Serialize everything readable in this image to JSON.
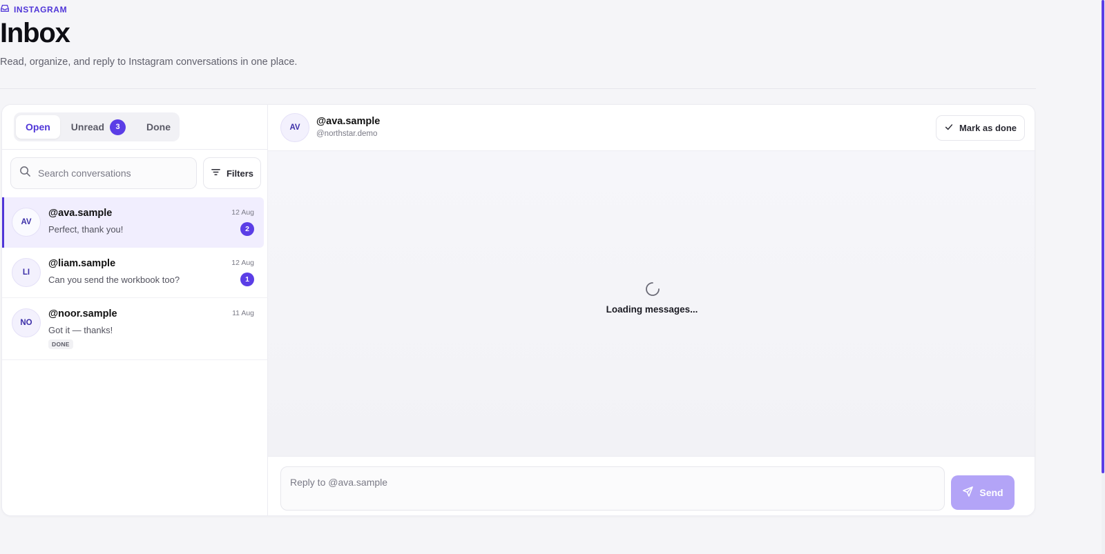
{
  "header": {
    "eyebrow": "INSTAGRAM",
    "title": "Inbox",
    "subtitle": "Read, organize, and reply to Instagram conversations in one place."
  },
  "tabs": [
    {
      "label": "Open",
      "active": true
    },
    {
      "label": "Unread",
      "count": "3"
    },
    {
      "label": "Done"
    }
  ],
  "search": {
    "placeholder": "Search conversations",
    "value": "",
    "filters_label": "Filters"
  },
  "conversations": [
    {
      "initials": "AV",
      "name": "@ava.sample",
      "preview": "Perfect, thank you!",
      "date": "12 Aug",
      "unread": "2",
      "selected": true
    },
    {
      "initials": "LI",
      "name": "@liam.sample",
      "preview": "Can you send the workbook too?",
      "date": "12 Aug",
      "unread": "1"
    },
    {
      "initials": "NO",
      "name": "@noor.sample",
      "preview": "Got it — thanks!",
      "date": "11 Aug",
      "tag": "DONE"
    }
  ],
  "thread": {
    "initials": "AV",
    "name": "@ava.sample",
    "handle": "@northstar.demo",
    "mark_done_label": "Mark as done",
    "loading_text": "Loading messages...",
    "reply_placeholder": "Reply to @ava.sample",
    "send_label": "Send"
  },
  "colors": {
    "accent": "#5b3ee6",
    "accent_text": "#4f35d8",
    "send_disabled": "#b3a4f7",
    "selected_row": "#f1eefe"
  },
  "icons": {
    "eyebrow": "inbox-icon",
    "search": "search-icon",
    "filters": "filter-lines-icon",
    "mark_done": "check-icon",
    "loading": "spinner-icon",
    "send": "paper-plane-icon"
  }
}
